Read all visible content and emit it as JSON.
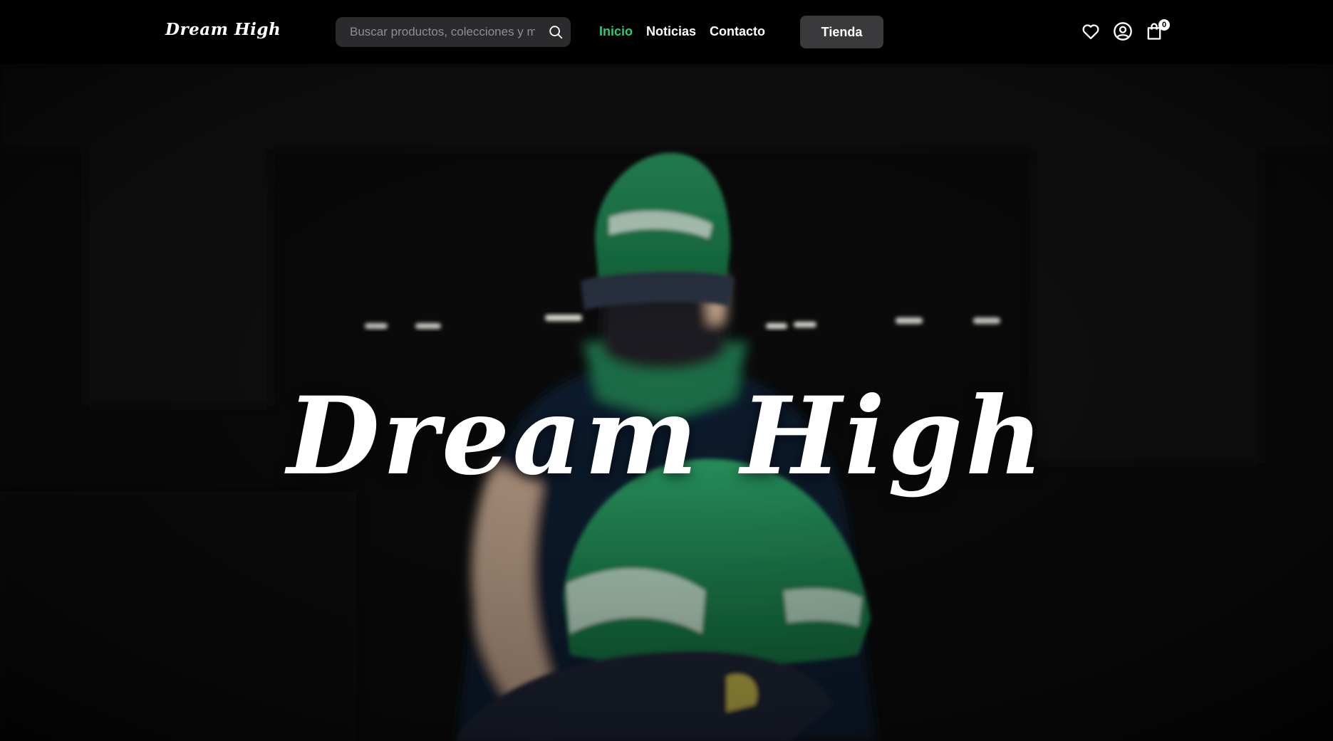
{
  "header": {
    "logo_text": "Dream High",
    "search": {
      "placeholder": "Buscar productos, colecciones y marcas",
      "icon": "search-icon"
    },
    "nav": [
      {
        "label": "Inicio",
        "active": true
      },
      {
        "label": "Noticias",
        "active": false
      },
      {
        "label": "Contacto",
        "active": false
      }
    ],
    "shop_button": "Tienda",
    "icons": {
      "wishlist": "heart-icon",
      "account": "user-icon",
      "cart": "bag-icon"
    },
    "cart_count": "0"
  },
  "hero": {
    "title": "Dream High",
    "image_alt": "person with green cap and face mask holding a green cap"
  },
  "colors": {
    "accent": "#2ecc71",
    "background": "#000000",
    "button_bg": "#3a3a3c",
    "search_bg": "#2b2b2d",
    "cap_green": "#1f7a4c"
  }
}
